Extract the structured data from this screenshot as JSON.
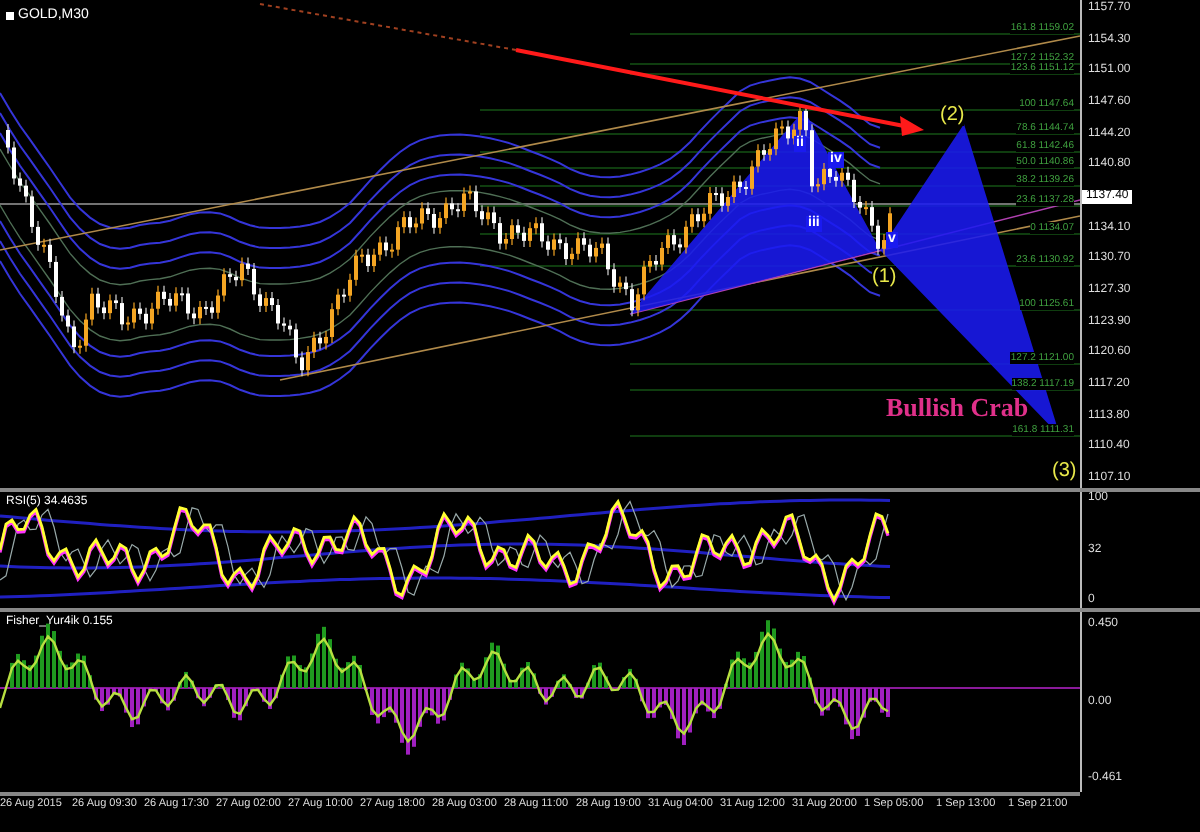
{
  "chart": {
    "symbol": "GOLD,M30",
    "price_axis": [
      {
        "label": "1157.70",
        "kind": "tick"
      },
      {
        "label": "1154.30",
        "kind": "tick"
      },
      {
        "label": "1151.00",
        "kind": "tick"
      },
      {
        "label": "1147.60",
        "kind": "tick"
      },
      {
        "label": "1144.20",
        "kind": "tick"
      },
      {
        "label": "1140.80",
        "kind": "tick"
      },
      {
        "label": "1137.40",
        "kind": "current"
      },
      {
        "label": "1134.10",
        "kind": "tick"
      },
      {
        "label": "1130.70",
        "kind": "tick"
      },
      {
        "label": "1127.30",
        "kind": "tick"
      },
      {
        "label": "1123.90",
        "kind": "tick"
      },
      {
        "label": "1120.60",
        "kind": "tick"
      },
      {
        "label": "1117.20",
        "kind": "tick"
      },
      {
        "label": "1113.80",
        "kind": "tick"
      },
      {
        "label": "1110.40",
        "kind": "tick"
      },
      {
        "label": "1107.10",
        "kind": "tick"
      }
    ],
    "fib_levels": [
      "161.8 1159.02",
      "127.2 1152.32",
      "123.6 1151.12",
      "100 1147.64",
      "78.6 1144.74",
      "61.8 1142.46",
      "50.0 1140.86",
      "38.2 1139.26",
      "23.6 1137.28",
      "0 1134.07",
      "23.6 1130.92",
      "100 1125.61",
      "127.2 1121.00",
      "138.2 1117.19",
      "161.8 1111.31"
    ],
    "wave_labels": [
      "ii",
      "iii",
      "iv",
      "v"
    ],
    "pattern_points": [
      "(1)",
      "(2)",
      "(3)"
    ],
    "pattern_name": "Bullish Crab"
  },
  "rsi": {
    "title": "RSI(5) 34.4635",
    "axis": [
      "100",
      "32",
      "0"
    ]
  },
  "fisher": {
    "title": "Fisher_Yur4ik 0.155",
    "axis": [
      "0.450",
      "0.00",
      "-0.461"
    ]
  },
  "time_axis": [
    "26 Aug 2015",
    "26 Aug 09:30",
    "26 Aug 17:30",
    "27 Aug 02:00",
    "27 Aug 10:00",
    "27 Aug 18:00",
    "28 Aug 03:00",
    "28 Aug 11:00",
    "28 Aug 19:00",
    "31 Aug 04:00",
    "31 Aug 12:00",
    "31 Aug 20:00",
    "1 Sep 05:00",
    "1 Sep 13:00",
    "1 Sep 21:00"
  ]
}
